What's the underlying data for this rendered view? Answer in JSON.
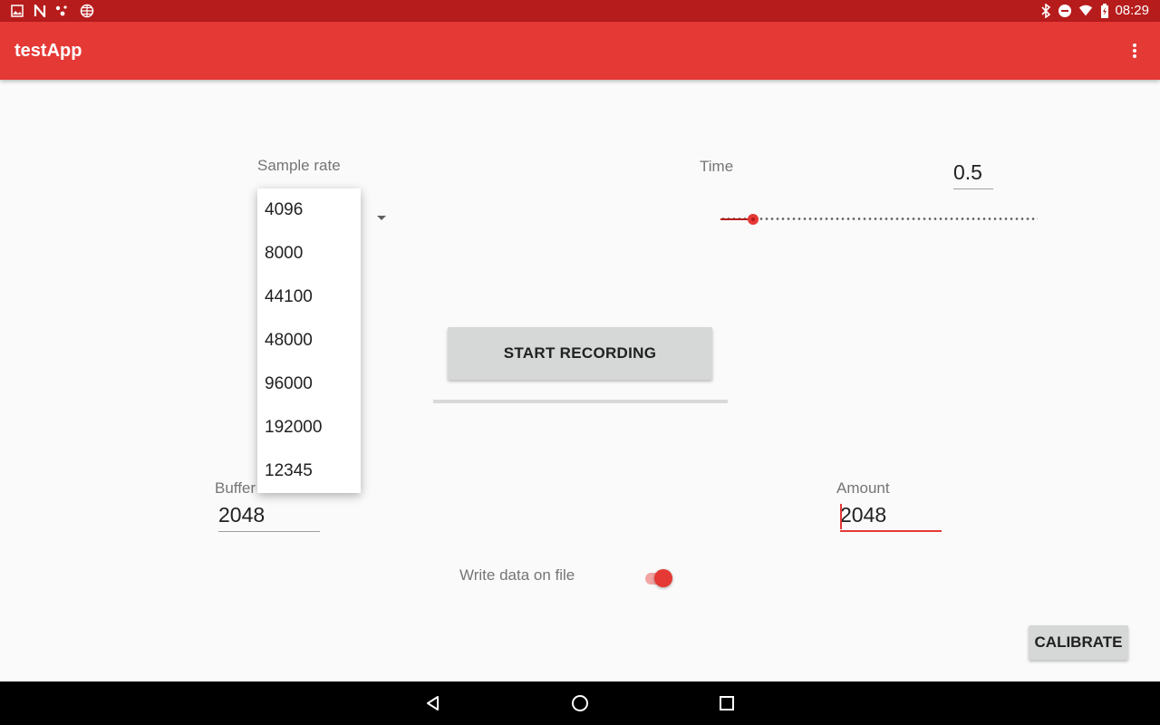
{
  "status_bar": {
    "time": "08:29",
    "left_icons": [
      "image-icon",
      "n-logo-icon",
      "dots-icon",
      "globe-icon"
    ],
    "right_icons": [
      "bluetooth-icon",
      "do-not-disturb-icon",
      "wifi-icon",
      "battery-icon"
    ]
  },
  "app_bar": {
    "title": "testApp",
    "overflow_icon": "more-vert-icon"
  },
  "sample_rate": {
    "label": "Sample rate",
    "options": [
      "4096",
      "8000",
      "44100",
      "48000",
      "96000",
      "192000",
      "12345"
    ]
  },
  "time": {
    "label": "Time",
    "value": "0.5",
    "slider_fraction": 0.1
  },
  "start_button": {
    "label": "START RECORDING"
  },
  "buffer": {
    "label": "Buffer",
    "value": "2048"
  },
  "amount": {
    "label": "Amount",
    "value": "2048"
  },
  "write_file": {
    "label": "Write data on file",
    "checked": true
  },
  "calibrate_button": {
    "label": "CALIBRATE"
  },
  "colors": {
    "primary": "#e53935",
    "primary_dark": "#b71c1c",
    "background": "#fafafa"
  }
}
